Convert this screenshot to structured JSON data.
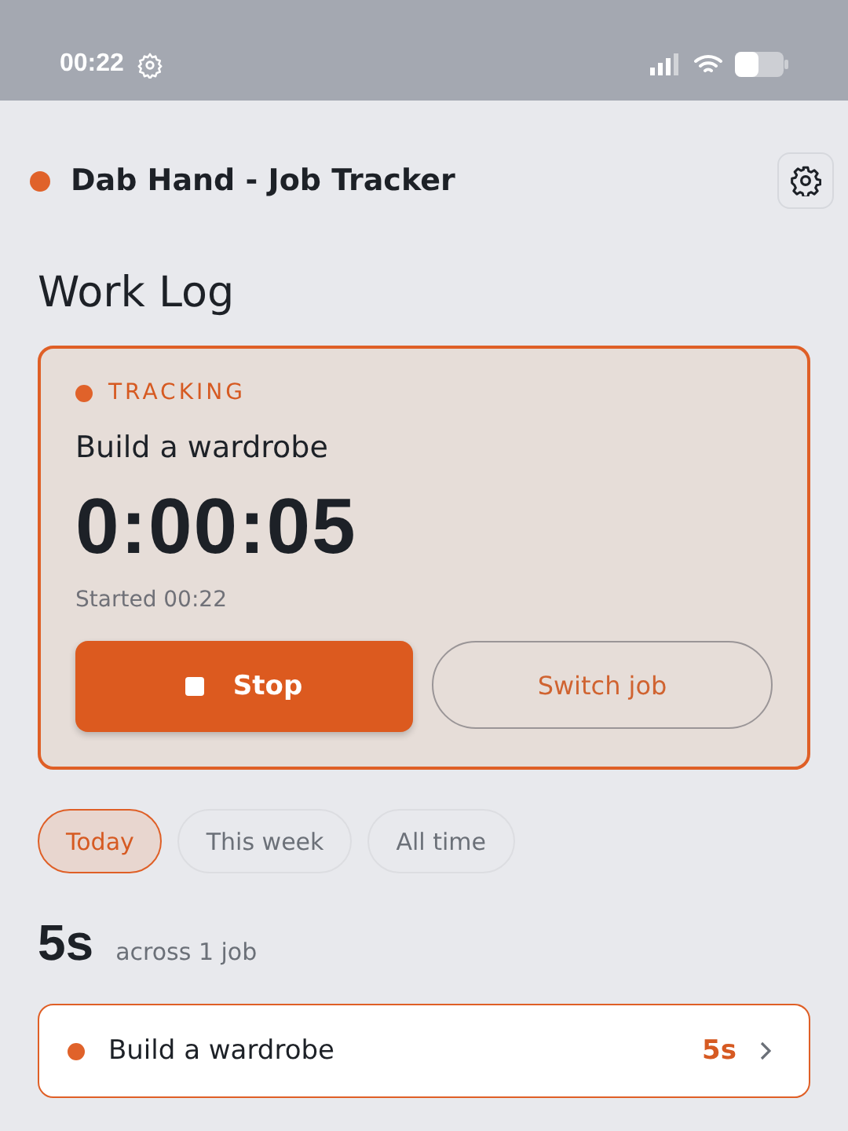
{
  "status_bar": {
    "time": "00:22"
  },
  "header": {
    "title": "Dab Hand - Job Tracker"
  },
  "page_title": "Work Log",
  "tracker": {
    "status": "TRACKING",
    "job": "Build a wardrobe",
    "elapsed": "0:00:05",
    "started": "Started 00:22",
    "stop_button": "Stop",
    "switch_button": "Switch job"
  },
  "filters": [
    {
      "label": "Today",
      "selected": true
    },
    {
      "label": "This week",
      "selected": false
    },
    {
      "label": "All time",
      "selected": false
    }
  ],
  "summary": {
    "total": "5s",
    "detail": "across 1 job"
  },
  "jobs": [
    {
      "name": "Build a wardrobe",
      "duration": "5s",
      "color": "#e0622a"
    }
  ]
}
